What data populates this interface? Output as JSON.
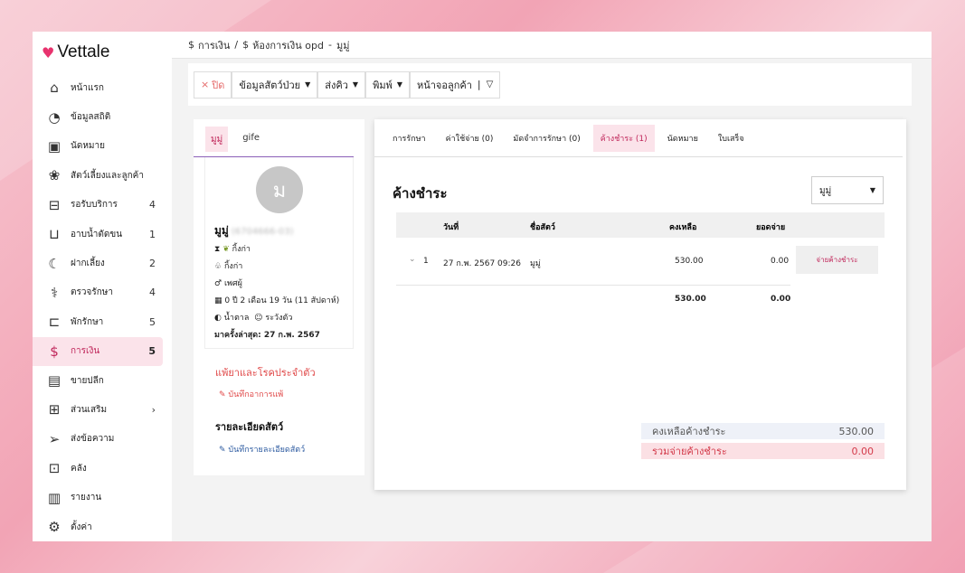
{
  "brand": {
    "name": "Vettale"
  },
  "sidebar": {
    "items": [
      {
        "label": "หน้าแรก",
        "count": ""
      },
      {
        "label": "ข้อมูลสถิติ",
        "count": ""
      },
      {
        "label": "นัดหมาย",
        "count": ""
      },
      {
        "label": "สัตว์เลี้ยงและลูกค้า",
        "count": ""
      },
      {
        "label": "รอรับบริการ",
        "count": "4"
      },
      {
        "label": "อาบน้ำตัดขน",
        "count": "1"
      },
      {
        "label": "ฝากเลี้ยง",
        "count": "2"
      },
      {
        "label": "ตรวจรักษา",
        "count": "4"
      },
      {
        "label": "พักรักษา",
        "count": "5"
      },
      {
        "label": "การเงิน",
        "count": "5"
      },
      {
        "label": "ขายปลีก",
        "count": ""
      },
      {
        "label": "ส่วนเสริม",
        "count": "›"
      },
      {
        "label": "ส่งข้อความ",
        "count": ""
      },
      {
        "label": "คลัง",
        "count": ""
      },
      {
        "label": "รายงาน",
        "count": ""
      },
      {
        "label": "ตั้งค่า",
        "count": ""
      }
    ]
  },
  "breadcrumb": {
    "root": "การเงิน",
    "sep": "/",
    "page": "ห้องการเงิน opd",
    "dash": "-",
    "patient": "มูมู่"
  },
  "toolbar": {
    "close": "ปิด",
    "pet_info": "ข้อมูลสัตว์ป่วย",
    "queue": "ส่งคิว",
    "print": "พิมพ์",
    "customer_screen": "หน้าจอลูกค้า"
  },
  "left": {
    "tabs": [
      "มูมู่",
      "gife"
    ],
    "avatar_letter": "ม",
    "pet_name": "มูมู่",
    "pet_code": "(6704666-03)",
    "breed_line": "กิ้งก่า",
    "species": "กิ้งก่า",
    "sex": "เพศผู้",
    "age": "0 ปี 2 เดือน 19 วัน (11 สัปดาห์)",
    "weight_tag": "น้ำตาล",
    "caution": "ระวังตัว",
    "last_visit": "มาครั้งล่าสุด: 27 ก.พ. 2567",
    "allergy_title": "แพ้ยาและโรคประจำตัว",
    "allergy_link": "บันทึกอาการแพ้",
    "detail_title": "รายละเอียดสัตว์",
    "detail_link": "บันทึกรายละเอียดสัตว์"
  },
  "right": {
    "tabs": [
      {
        "label": "การรักษา"
      },
      {
        "label": "ค่าใช้จ่าย (0)"
      },
      {
        "label": "มัดจำการรักษา (0)"
      },
      {
        "label": "ค้างชำระ (1)"
      },
      {
        "label": "นัดหมาย"
      },
      {
        "label": "ใบเสร็จ"
      }
    ],
    "title": "ค้างชำระ",
    "filter_value": "มูมู่",
    "columns": {
      "date": "วันที่",
      "pet": "ชื่อสัตว์",
      "remaining": "คงเหลือ",
      "paid": "ยอดจ่าย"
    },
    "rows": [
      {
        "index": "1",
        "date": "27 ก.พ. 2567 09:26",
        "pet": "มูมู่",
        "remaining": "530.00",
        "paid": "0.00"
      }
    ],
    "totals": {
      "remaining": "530.00",
      "paid": "0.00"
    },
    "pay_button": "จ่ายค้างชำระ",
    "summary": [
      {
        "label": "คงเหลือค้างชำระ",
        "value": "530.00"
      },
      {
        "label": "รวมจ่ายค้างชำระ",
        "value": "0.00"
      }
    ]
  },
  "colors": {
    "accent": "#c0265a",
    "accent_bg": "#fbe3ea",
    "close_red": "#e56a6a"
  }
}
